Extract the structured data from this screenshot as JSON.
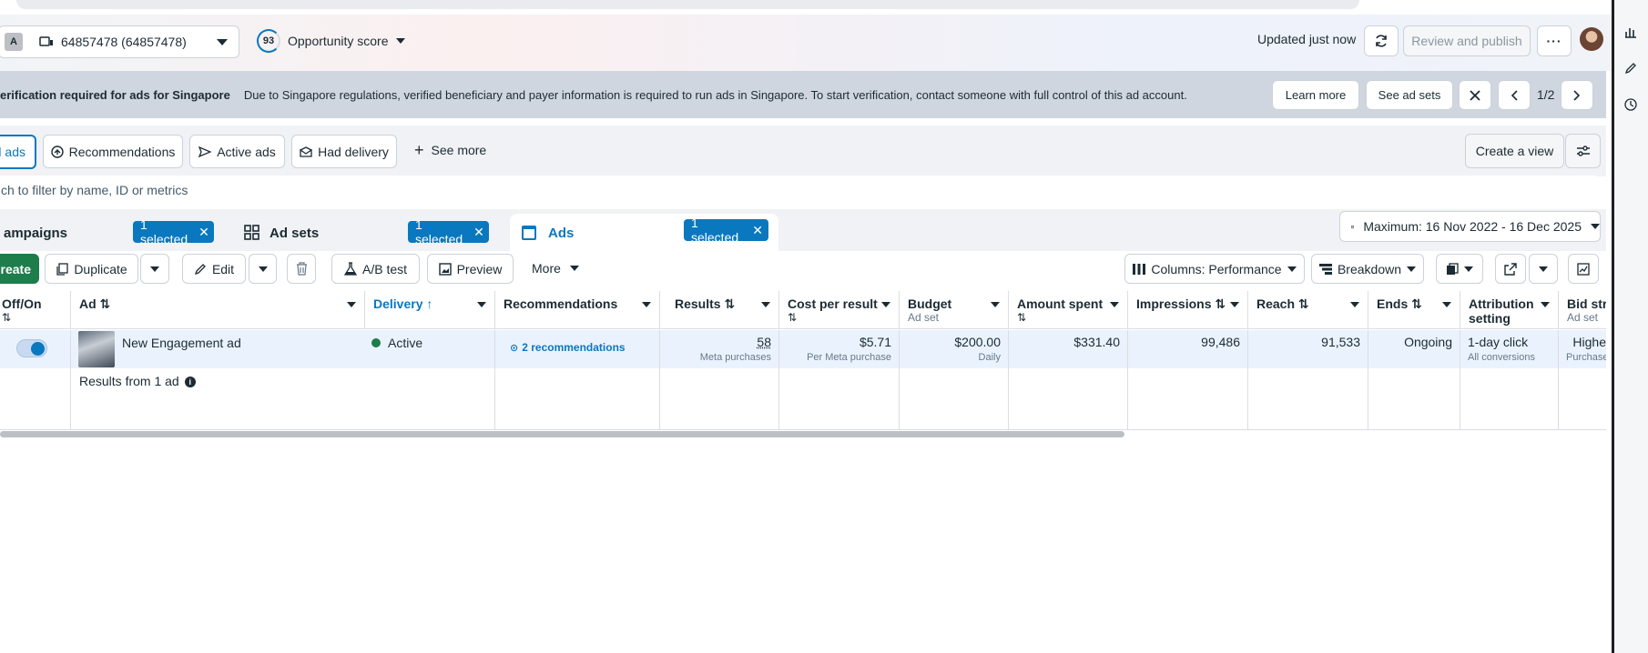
{
  "header": {
    "account_badge": "A",
    "account_name": "64857478 (64857478)",
    "opportunity_score": "93",
    "opportunity_label": "Opportunity score",
    "updated": "Updated just now",
    "review_publish": "Review and publish"
  },
  "banner": {
    "title": "erification required for ads for Singapore",
    "text": "Due to Singapore regulations, verified beneficiary and payer information is required to run ads in Singapore. To start verification, contact someone with full control of this ad account.",
    "learn_more": "Learn more",
    "see_ad_sets": "See ad sets",
    "pager": "1/2"
  },
  "views": {
    "all_ads": "ll ads",
    "recommendations": "Recommendations",
    "active_ads": "Active ads",
    "had_delivery": "Had delivery",
    "see_more": "See more",
    "create_view": "Create a view"
  },
  "search": {
    "placeholder": "ch to filter by name, ID or metrics"
  },
  "tabs": {
    "campaigns": "ampaigns",
    "ad_sets": "Ad sets",
    "ads": "Ads",
    "selected": "1 selected",
    "date_range": "Maximum: 16 Nov 2022 - 16 Dec 2025"
  },
  "toolbar": {
    "create": "reate",
    "duplicate": "Duplicate",
    "edit": "Edit",
    "ab_test": "A/B test",
    "preview": "Preview",
    "more": "More",
    "columns": "Columns: Performance",
    "breakdown": "Breakdown"
  },
  "table": {
    "headers": {
      "offon": "Off/On",
      "ad": "Ad",
      "delivery": "Delivery",
      "recommendations": "Recommendations",
      "results": "Results",
      "cost_per_result": "Cost per result",
      "budget": "Budget",
      "budget_sub": "Ad set",
      "amount_spent": "Amount spent",
      "impressions": "Impressions",
      "reach": "Reach",
      "ends": "Ends",
      "attribution": "Attribution setting",
      "bid_strategy": "Bid stra",
      "bid_sub": "Ad set"
    },
    "row": {
      "ad_name": "New Engagement ad",
      "delivery": "Active",
      "recommendations": "2 recommendations",
      "results": "58",
      "results_sub": "Meta purchases",
      "cost": "$5.71",
      "cost_sub": "Per Meta purchase",
      "budget": "$200.00",
      "budget_sub": "Daily",
      "amount_spent": "$331.40",
      "impressions": "99,486",
      "reach": "91,533",
      "ends": "Ongoing",
      "attribution": "1-day click",
      "attribution_sub": "All conversions",
      "bid": "Highe",
      "bid_sub": "Purchase"
    },
    "footer": {
      "results_from": "Results from 1 ad"
    }
  },
  "colors": {
    "accent": "#0a78be",
    "create_green": "#1d7d4b",
    "active_dot": "#1d7d4b"
  }
}
